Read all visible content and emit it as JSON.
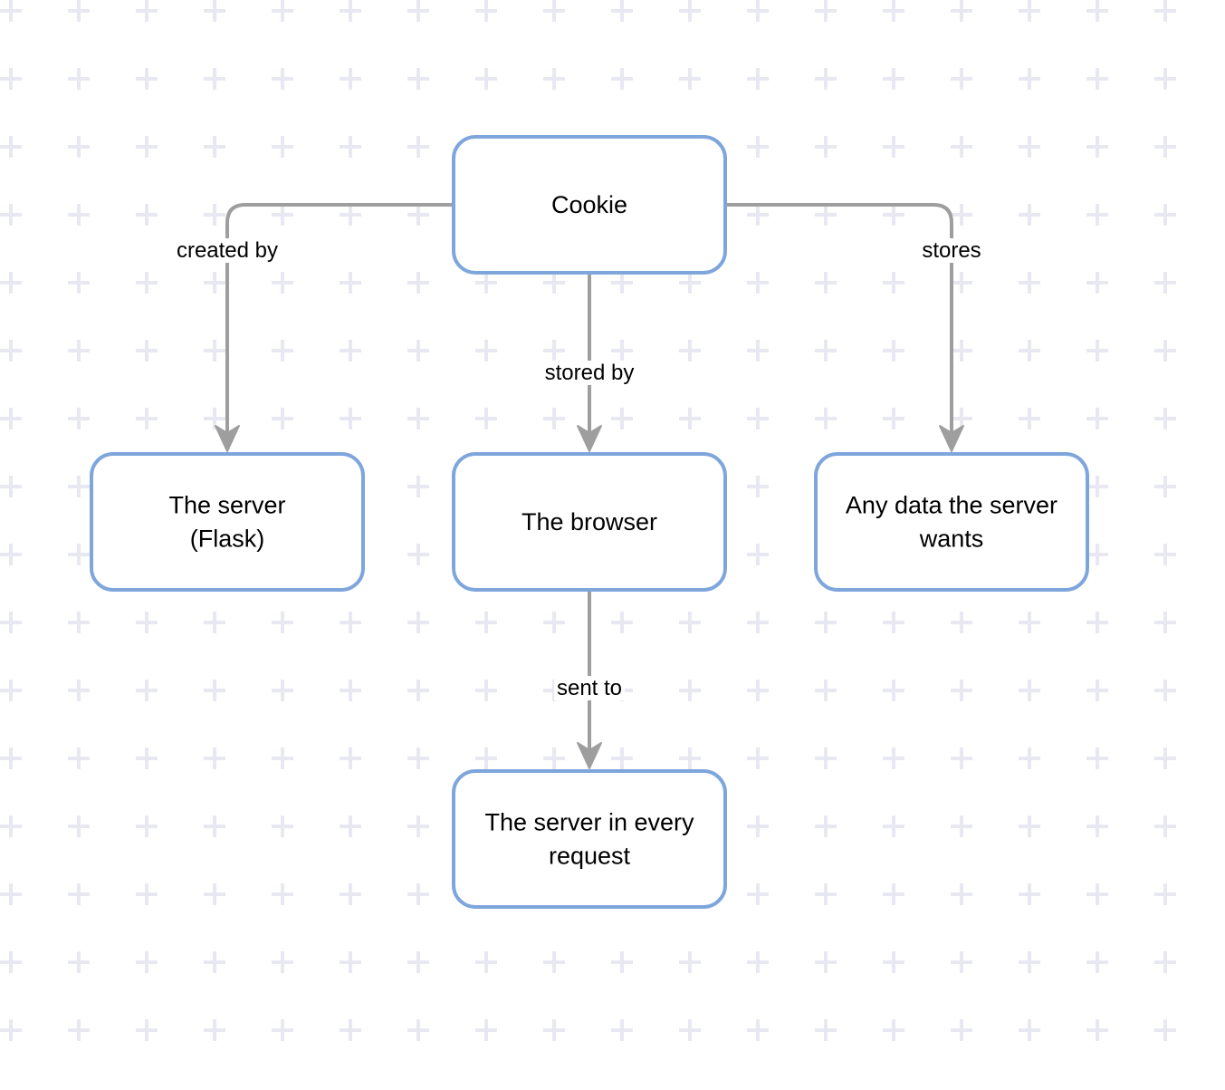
{
  "diagram": {
    "colors": {
      "node_border": "#7ea6dc",
      "node_fill": "#ffffff",
      "edge": "#9e9e9e",
      "grid": "#e8e8f2",
      "background": "#ffffff"
    },
    "nodes": [
      {
        "id": "cookie",
        "lines": [
          "Cookie"
        ]
      },
      {
        "id": "server-flask",
        "lines": [
          "The server",
          "(Flask)"
        ]
      },
      {
        "id": "browser",
        "lines": [
          "The browser"
        ]
      },
      {
        "id": "any-data",
        "lines": [
          "Any data the server",
          "wants"
        ]
      },
      {
        "id": "server-every-request",
        "lines": [
          "The server in every",
          "request"
        ]
      }
    ],
    "edges": [
      {
        "from": "cookie",
        "to": "server-flask",
        "label": "created by"
      },
      {
        "from": "cookie",
        "to": "browser",
        "label": "stored by"
      },
      {
        "from": "cookie",
        "to": "any-data",
        "label": "stores"
      },
      {
        "from": "browser",
        "to": "server-every-request",
        "label": "sent to"
      }
    ]
  }
}
